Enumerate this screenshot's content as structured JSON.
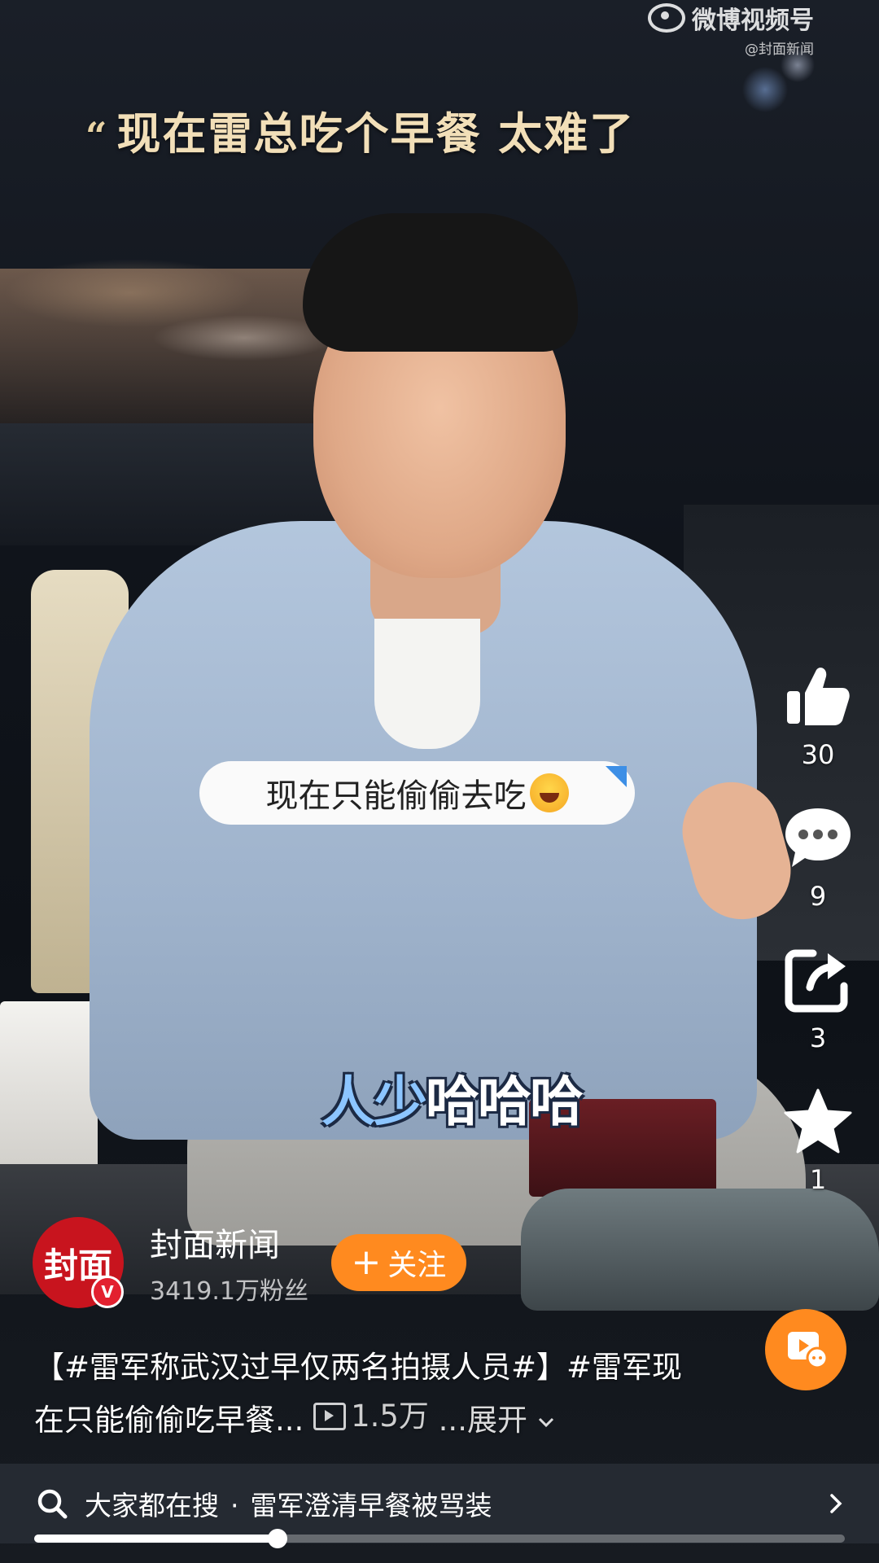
{
  "watermark": {
    "brand": "微博视频号",
    "source": "@封面新闻"
  },
  "video": {
    "quote_mark": "“",
    "quote_text": "现在雷总吃个早餐 太难了",
    "danmaku_text": "现在只能偷偷去吃",
    "caption_blue": "人少",
    "caption_white": "哈哈哈"
  },
  "actions": {
    "like_count": "30",
    "comment_count": "9",
    "share_count": "3",
    "favorite_count": "1"
  },
  "author": {
    "avatar_text": "封面",
    "verified_badge": "V",
    "name": "封面新闻",
    "fans": "3419.1万粉丝",
    "follow_label": "关注",
    "follow_plus": "+"
  },
  "post": {
    "description": "【#雷军称武汉过早仅两名拍摄人员#】#雷军现在只能偷偷吃早餐...",
    "views": "1.5万",
    "expand_label": "...展开"
  },
  "search": {
    "prefix": "大家都在搜",
    "separator": "·",
    "query": "雷军澄清早餐被骂装"
  },
  "playback": {
    "progress": 0.3
  },
  "icons": {
    "like": "thumbs-up-icon",
    "comment": "chat-bubble-icon",
    "share": "share-arrow-icon",
    "favorite": "star-icon",
    "record": "video-record-icon",
    "search": "search-icon",
    "chevron": "chevron-right-icon"
  },
  "colors": {
    "accent": "#ff8a1f",
    "avatar_red": "#c8141e"
  }
}
